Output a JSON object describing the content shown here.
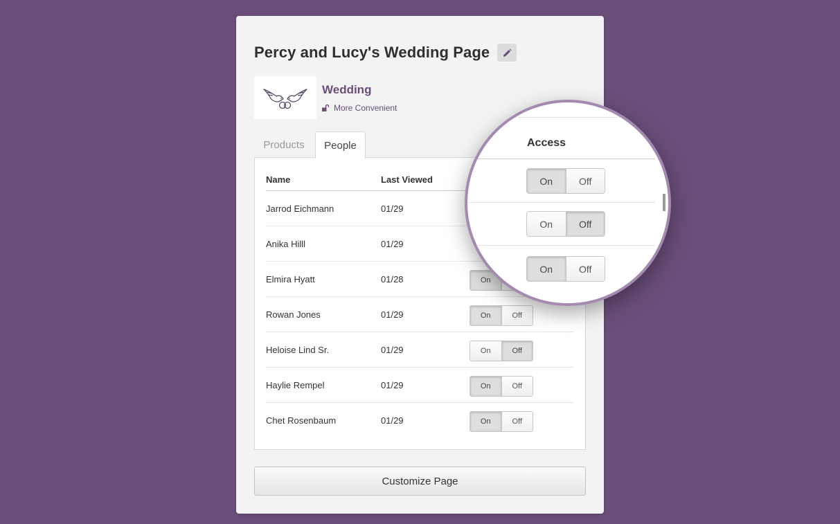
{
  "page": {
    "title": "Percy and Lucy's Wedding Page",
    "edit_icon": "pencil-icon"
  },
  "plan": {
    "logo_icon": "lovebirds-rings-icon",
    "name": "Wedding",
    "subtitle": "More Convenient",
    "subtitle_icon": "unlock-icon"
  },
  "tabs": [
    {
      "label": "Products",
      "active": false
    },
    {
      "label": "People",
      "active": true
    }
  ],
  "table": {
    "columns": {
      "name": "Name",
      "last_viewed": "Last Viewed",
      "access": "Access"
    },
    "rows": [
      {
        "name": "Jarrod Eichmann",
        "last_viewed": "01/29",
        "access": "On"
      },
      {
        "name": "Anika Hilll",
        "last_viewed": "01/29",
        "access": "Off"
      },
      {
        "name": "Elmira Hyatt",
        "last_viewed": "01/28",
        "access": "On"
      },
      {
        "name": "Rowan Jones",
        "last_viewed": "01/29",
        "access": "On"
      },
      {
        "name": "Heloise Lind Sr.",
        "last_viewed": "01/29",
        "access": "Off"
      },
      {
        "name": "Haylie Rempel",
        "last_viewed": "01/29",
        "access": "On"
      },
      {
        "name": "Chet Rosenbaum",
        "last_viewed": "01/29",
        "access": "On"
      }
    ],
    "toggle_labels": {
      "on": "On",
      "off": "Off"
    }
  },
  "actions": {
    "customize_label": "Customize Page"
  },
  "colors": {
    "background": "#6a4e79",
    "accent": "#6a4e79",
    "magnifier_ring": "#a48ab0"
  }
}
